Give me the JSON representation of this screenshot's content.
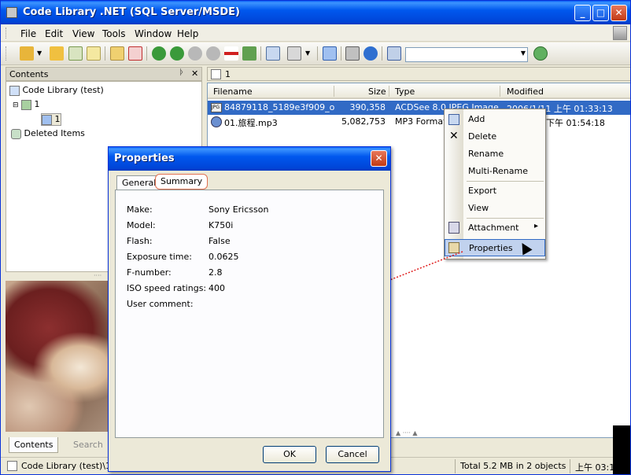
{
  "app": {
    "title": "Code Library .NET (SQL Server/MSDE)"
  },
  "window_buttons": {
    "minimize": "_",
    "maximize": "□",
    "close": "✕"
  },
  "menu": [
    "File",
    "Edit",
    "View",
    "Tools",
    "Window",
    "Help"
  ],
  "toolbar": {
    "icons": [
      "open-dropdown-icon",
      "open-folder-icon",
      "refresh-icon",
      "notes-icon",
      "new-folder-icon",
      "delete-icon",
      "back-icon",
      "forward-icon",
      "up-icon",
      "down-icon",
      "unknown-icon",
      "import-icon",
      "export-icon",
      "print-icon",
      "window-icon",
      "tools-icon",
      "help-icon",
      "find-icon",
      "web-icon"
    ],
    "combo_value": ""
  },
  "contents_pane": {
    "title": "Contents",
    "tree": [
      {
        "label": "Code Library (test)",
        "icon": "library-icon"
      },
      {
        "label": "1",
        "icon": "folder-icon"
      },
      {
        "label": "1",
        "icon": "folder-icon"
      },
      {
        "label": "Deleted Items",
        "icon": "recycle-icon"
      }
    ],
    "bottom_tabs": [
      "Contents",
      "Search"
    ]
  },
  "document_tab": {
    "label": "1"
  },
  "file_list": {
    "columns": [
      "Filename",
      "Size",
      "Type",
      "Modified"
    ],
    "rows": [
      {
        "filename": "84879118_5189e3f909_o...",
        "size": "390,358",
        "type": "ACDSee 8.0 JPEG Image",
        "modified": "2006/1/11 上午 01:33:13"
      },
      {
        "filename": "01.旅程.mp3",
        "size": "5,082,753",
        "type": "MP3 Format Sound",
        "modified": "下午 01:54:18"
      }
    ]
  },
  "context_menu": {
    "items": [
      "Add",
      "Delete",
      "Rename",
      "Multi-Rename",
      "Export",
      "View",
      "Attachment",
      "Properties"
    ],
    "submenu_arrow": "▸"
  },
  "status": {
    "path": "Code Library (test)\\1\\1",
    "total": "Total 5.2 MB in 2 objects",
    "time": "上午 03:1"
  },
  "dialog": {
    "title": "Properties",
    "tabs": [
      "General",
      "Summary"
    ],
    "active_tab": "Summary",
    "properties": [
      {
        "key": "Make:",
        "value": "Sony Ericsson"
      },
      {
        "key": "Model:",
        "value": "K750i"
      },
      {
        "key": "Flash:",
        "value": "False"
      },
      {
        "key": "Exposure time:",
        "value": "0.0625"
      },
      {
        "key": "F-number:",
        "value": "2.8"
      },
      {
        "key": "ISO speed ratings:",
        "value": "400"
      },
      {
        "key": "User comment:",
        "value": ""
      }
    ],
    "ok_label": "OK",
    "cancel_label": "Cancel",
    "close_glyph": "✕"
  },
  "colors": {
    "titlebar": "#0058ee",
    "selection": "#316ac5",
    "menu_highlight": "#c1d2ee",
    "arrow": "#e02020"
  }
}
